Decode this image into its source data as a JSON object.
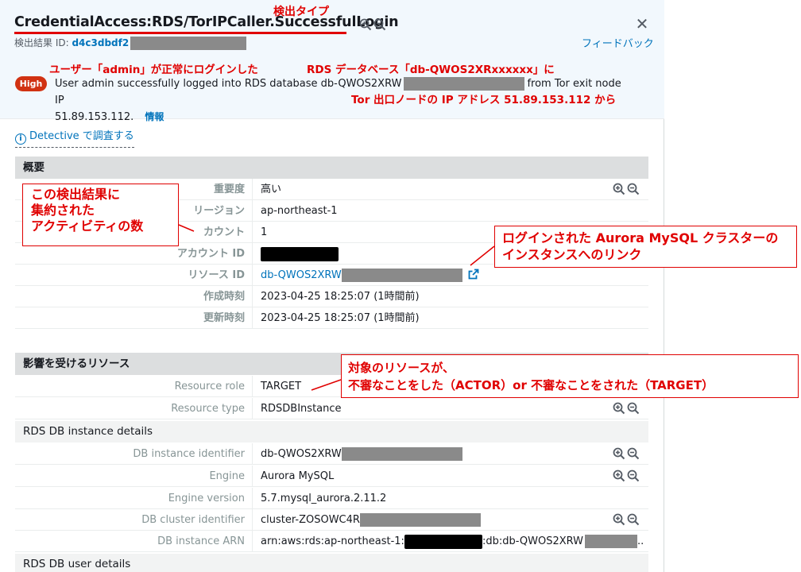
{
  "header": {
    "finding_type": "CredentialAccess:RDS/TorIPCaller.SuccessfulLogin",
    "finding_id_label": "検出結果 ID:",
    "finding_id_value": "d4c3dbdf2",
    "feedback_label": "フィードバック",
    "close_glyph": "✕"
  },
  "summary": {
    "severity": "High",
    "text_before": "User admin successfully logged into RDS database db-QWOS2XRW",
    "text_after": "from Tor exit node IP",
    "text_line2": "51.89.153.112.",
    "info_label": "情報"
  },
  "detective_link": "Detective で調査する",
  "overview": {
    "title": "概要",
    "rows": [
      {
        "label": "重要度",
        "value": "高い"
      },
      {
        "label": "リージョン",
        "value": "ap-northeast-1"
      },
      {
        "label": "カウント",
        "value": "1"
      },
      {
        "label": "アカウント ID",
        "value": ""
      },
      {
        "label": "リソース ID",
        "value": "db-QWOS2XRW"
      },
      {
        "label": "作成時刻",
        "value": "2023-04-25 18:25:07 (1時間前)"
      },
      {
        "label": "更新時刻",
        "value": "2023-04-25 18:25:07 (1時間前)"
      }
    ]
  },
  "affected": {
    "title": "影響を受けるリソース",
    "rows": [
      {
        "label": "Resource role",
        "value": "TARGET"
      },
      {
        "label": "Resource type",
        "value": "RDSDBInstance"
      }
    ],
    "instance_details_title": "RDS DB instance details",
    "instance_rows": [
      {
        "label": "DB instance identifier",
        "value": "db-QWOS2XRW"
      },
      {
        "label": "Engine",
        "value": "Aurora MySQL"
      },
      {
        "label": "Engine version",
        "value": "5.7.mysql_aurora.2.11.2"
      },
      {
        "label": "DB cluster identifier",
        "value": "cluster-ZOSOWC4R"
      },
      {
        "label": "DB instance ARN",
        "value_prefix": "arn:aws:rds:ap-northeast-1:",
        "value_mid": ":db:db-QWOS2XRW",
        "value_suffix": ".."
      }
    ],
    "user_details_title": "RDS DB user details"
  },
  "annotations": {
    "finding_type": "検出タイプ",
    "user_login": "ユーザー「admin」が正常にログインした",
    "rds_db": "RDS データベース「db-QWOS2XRxxxxxx」に",
    "tor_ip": "Tor 出口ノードの IP アドレス 51.89.153.112 から",
    "count_line1": "この検出結果に",
    "count_line2": "集約された",
    "count_line3": "アクティビティの数",
    "link_line1": "ログインされた Aurora MySQL クラスターの",
    "link_line2": "インスタンスへのリンク",
    "role_line1": "対象のリソースが、",
    "role_line2": "不審なことをした（ACTOR）or 不審なことをされた（TARGET）"
  },
  "colors": {
    "accent_link": "#0073bb",
    "severity_high": "#d13212",
    "annotation_red": "#e00000",
    "header_bg": "#f2f8fd"
  }
}
